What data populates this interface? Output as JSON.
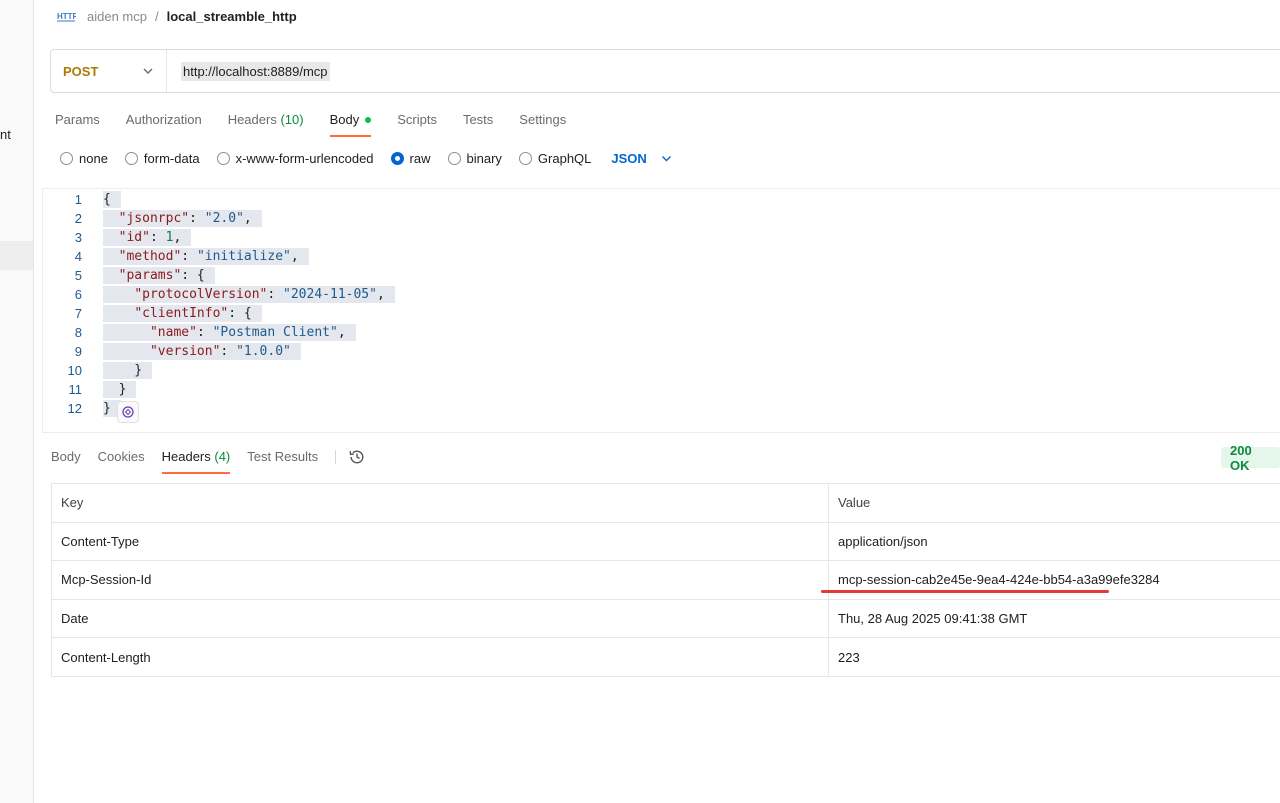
{
  "sidebar": {
    "fragment_text": "nt"
  },
  "breadcrumb": {
    "icon": "http-icon",
    "parent": "aiden mcp",
    "separator": "/",
    "current": "local_streamble_http"
  },
  "request": {
    "method": "POST",
    "url": "http://localhost:8889/mcp"
  },
  "request_tabs": [
    {
      "label": "Params"
    },
    {
      "label": "Authorization"
    },
    {
      "label": "Headers",
      "count": "(10)"
    },
    {
      "label": "Body",
      "active": true,
      "indicator": "green-dot"
    },
    {
      "label": "Scripts"
    },
    {
      "label": "Tests"
    },
    {
      "label": "Settings"
    }
  ],
  "body_types": {
    "options": [
      "none",
      "form-data",
      "x-www-form-urlencoded",
      "raw",
      "binary",
      "GraphQL"
    ],
    "selected": "raw",
    "language": "JSON"
  },
  "editor": {
    "line_numbers": [
      "1",
      "2",
      "3",
      "4",
      "5",
      "6",
      "7",
      "8",
      "9",
      "10",
      "11",
      "12"
    ],
    "lines": [
      "{",
      "\"jsonrpc\": \"2.0\",",
      "\"id\": 1,",
      "\"method\": \"initialize\",",
      "\"params\": {",
      "\"protocolVersion\": \"2024-11-05\",",
      "\"clientInfo\": {",
      "\"name\": \"Postman Client\",",
      "\"version\": \"1.0.0\"",
      "}",
      "}",
      "}"
    ]
  },
  "response_tabs": [
    {
      "label": "Body"
    },
    {
      "label": "Cookies"
    },
    {
      "label": "Headers",
      "count": "(4)",
      "active": true
    },
    {
      "label": "Test Results"
    }
  ],
  "response_status": "200 OK",
  "response_headers": {
    "columns": [
      "Key",
      "Value"
    ],
    "rows": [
      {
        "key": "Content-Type",
        "value": "application/json"
      },
      {
        "key": "Mcp-Session-Id",
        "value": "mcp-session-cab2e45e-9ea4-424e-bb54-a3a99efe3284"
      },
      {
        "key": "Date",
        "value": "Thu, 28 Aug 2025 09:41:38 GMT"
      },
      {
        "key": "Content-Length",
        "value": "223"
      }
    ]
  },
  "colors": {
    "method": "#ad7a03",
    "accent_tab": "#ff6c37",
    "status_green": "#0d8a3f",
    "link_blue": "#0265d2",
    "highlight_underline": "#e53935"
  }
}
